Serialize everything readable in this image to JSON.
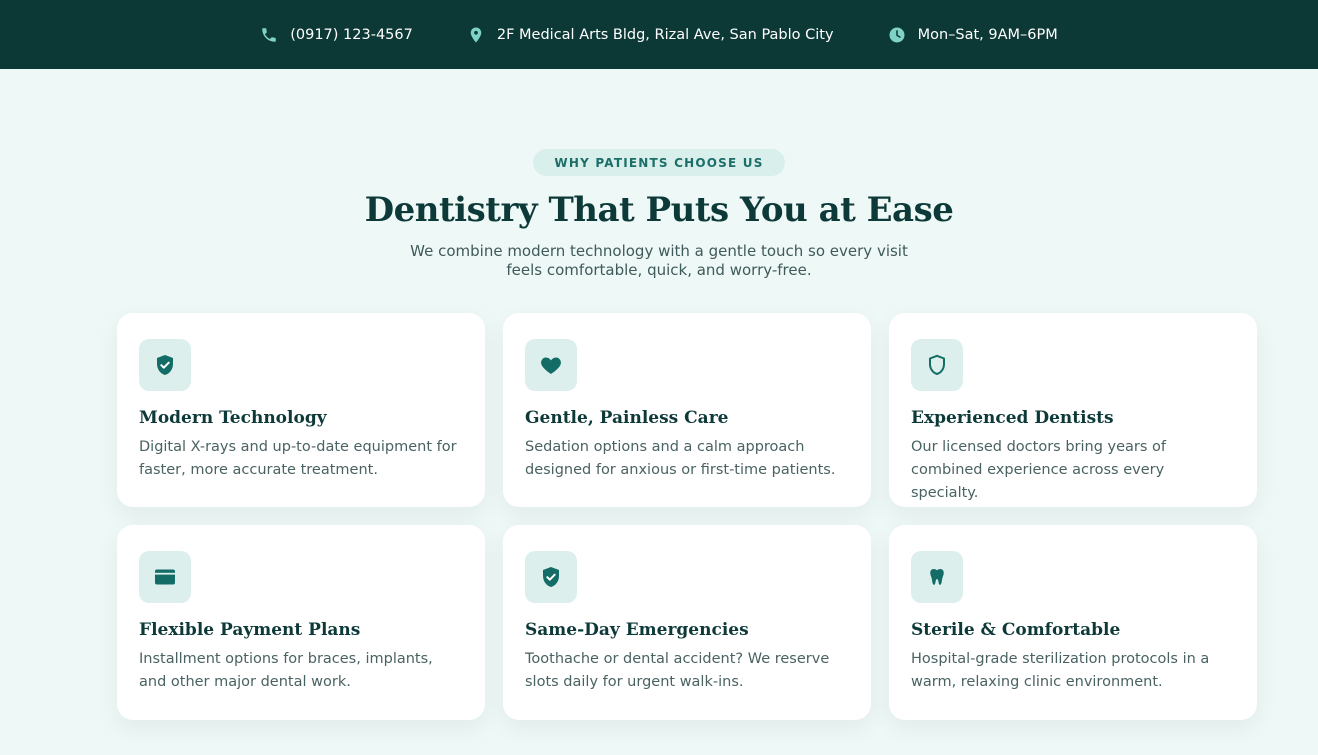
{
  "topbar": {
    "phone": "(0917) 123-4567",
    "address": "2F Medical Arts Bldg, Rizal Ave, San Pablo City",
    "hours": "Mon–Sat, 9AM–6PM",
    "icons": [
      "phone-icon",
      "map-pin-icon",
      "clock-icon"
    ]
  },
  "section": {
    "eyebrow": "WHY PATIENTS CHOOSE US",
    "heading": "Dentistry That Puts You at Ease",
    "subtitle": "We combine modern technology with a gentle touch so every visit feels comfortable, quick, and worry-free."
  },
  "features": [
    {
      "icon": "shield-check-icon",
      "title": "Modern Technology",
      "description": "Digital X-rays and up-to-date equipment for faster, more accurate treatment."
    },
    {
      "icon": "heart-icon",
      "title": "Gentle, Painless Care",
      "description": "Sedation options and a calm approach designed for anxious or first-time patients."
    },
    {
      "icon": "shield-outline-icon",
      "title": "Experienced Dentists",
      "description": "Our licensed doctors bring years of combined experience across every specialty."
    },
    {
      "icon": "credit-card-icon",
      "title": "Flexible Payment Plans",
      "description": "Installment options for braces, implants, and other major dental work."
    },
    {
      "icon": "shield-check-icon",
      "title": "Same-Day Emergencies",
      "description": "Toothache or dental accident? We reserve slots daily for urgent walk-ins."
    },
    {
      "icon": "tooth-icon",
      "title": "Sterile & Comfortable",
      "description": "Hospital-grade sterilization protocols in a warm, relaxing clinic environment."
    }
  ],
  "colors": {
    "topbar_bg": "#0c3836",
    "accent": "#1c6e68",
    "page_bg": "#eef8f6",
    "icon_bg": "#dcefec"
  }
}
